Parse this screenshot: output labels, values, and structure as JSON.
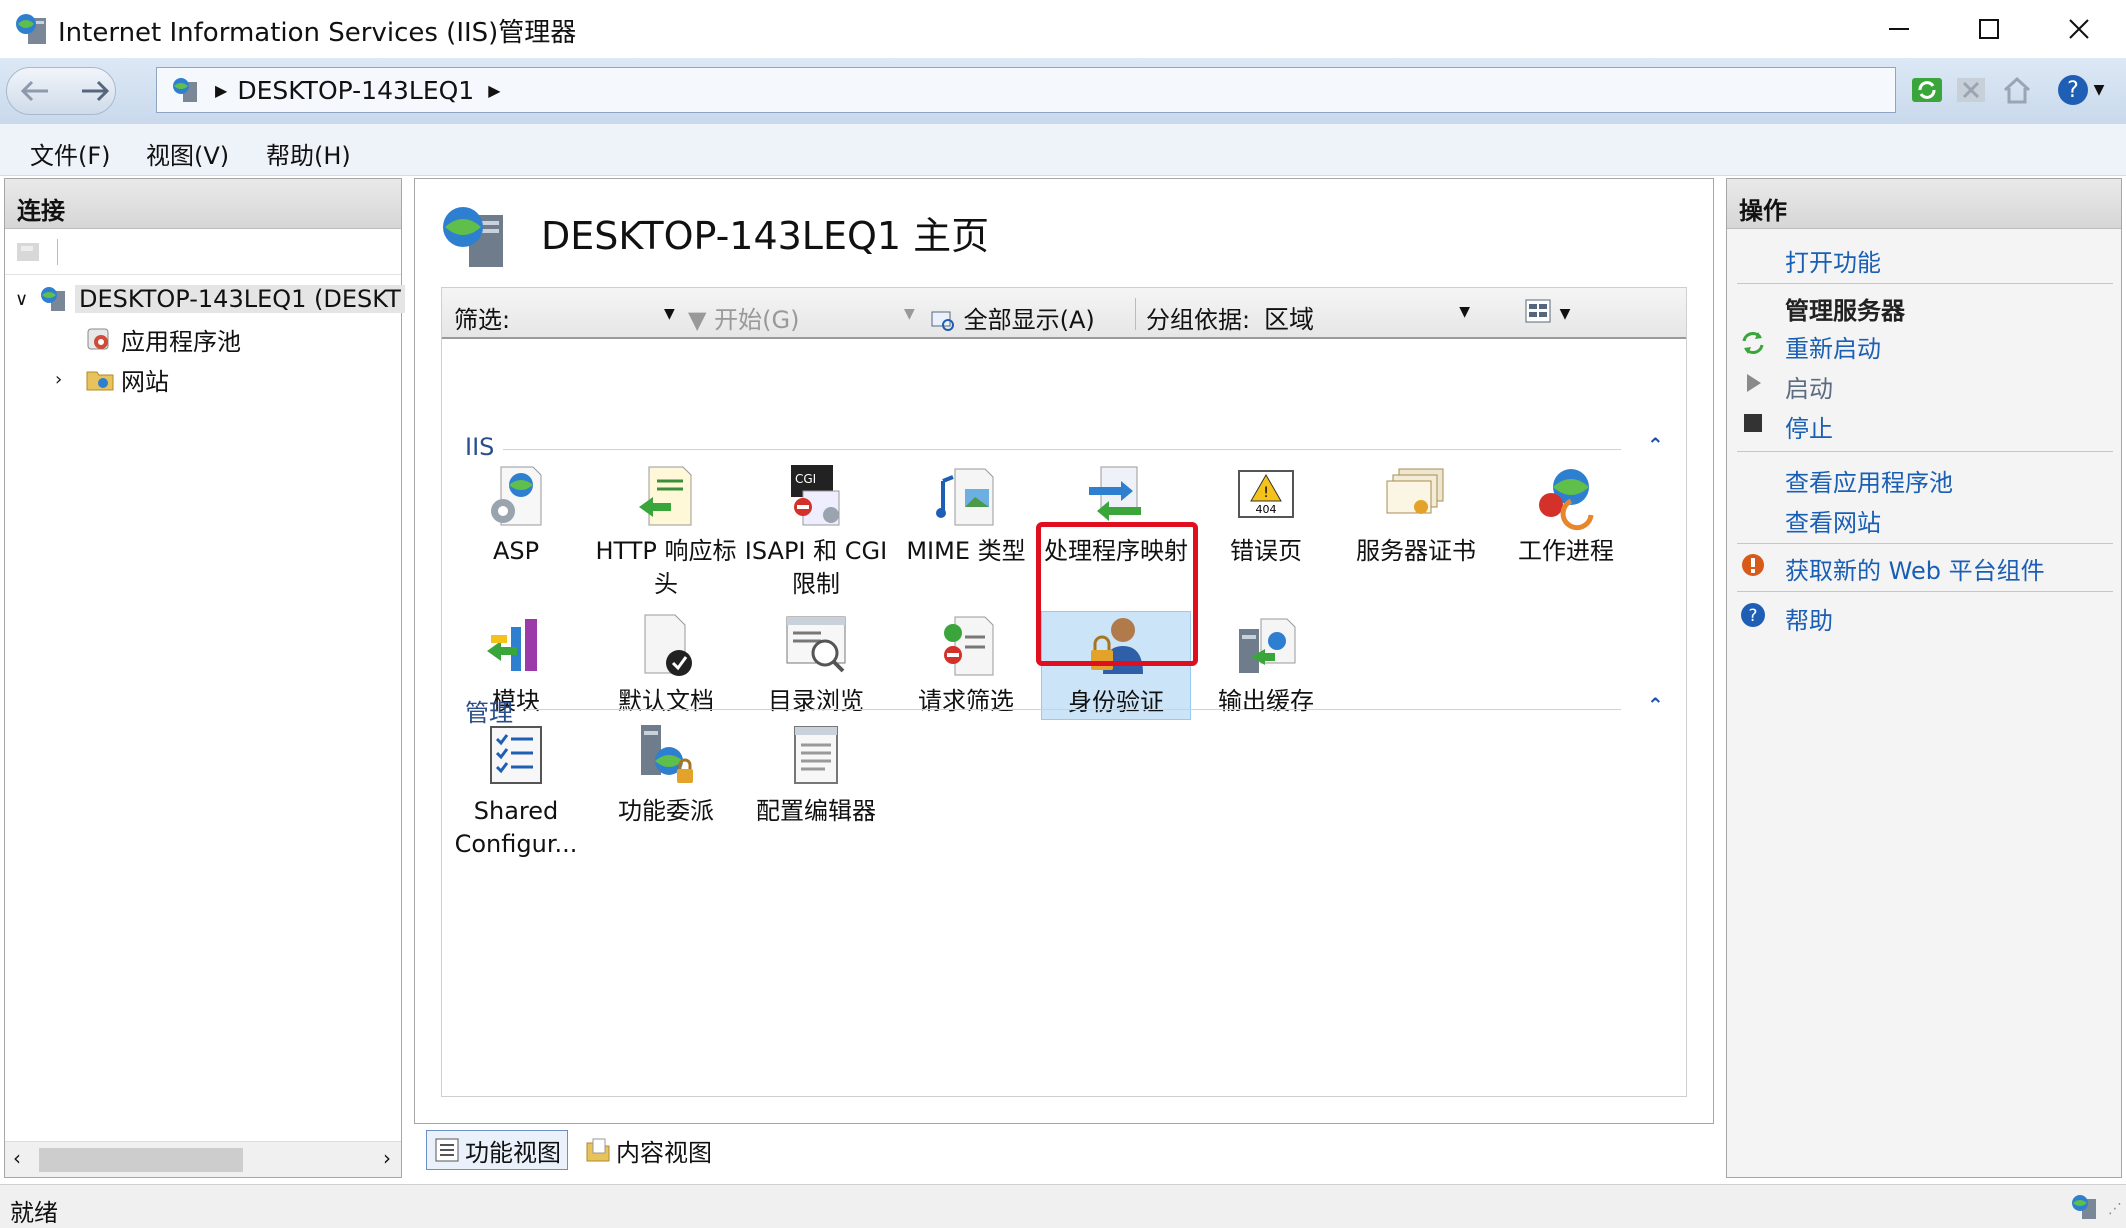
{
  "window": {
    "title": "Internet Information Services (IIS)管理器"
  },
  "address": {
    "crumbs": [
      "DESKTOP-143LEQ1"
    ]
  },
  "menu": {
    "items": [
      "文件(F)",
      "视图(V)",
      "帮助(H)"
    ]
  },
  "connections": {
    "title": "连接",
    "tree": {
      "root": "DESKTOP-143LEQ1 (DESKT",
      "children": [
        "应用程序池",
        "网站"
      ]
    }
  },
  "center": {
    "title": "DESKTOP-143LEQ1 主页",
    "filter": {
      "label": "筛选:",
      "value": "",
      "start": "开始(G)",
      "show_all": "全部显示(A)",
      "group_by_label": "分组依据:",
      "group_by_value": "区域"
    },
    "groups": [
      {
        "name": "IIS",
        "features": [
          {
            "label": "ASP",
            "icon": "asp-icon"
          },
          {
            "label": "HTTP 响应标头",
            "icon": "http-headers-icon"
          },
          {
            "label": "ISAPI 和 CGI 限制",
            "icon": "isapi-cgi-icon"
          },
          {
            "label": "MIME 类型",
            "icon": "mime-icon"
          },
          {
            "label": "处理程序映射",
            "icon": "handler-mappings-icon"
          },
          {
            "label": "错误页",
            "icon": "error-page-icon"
          },
          {
            "label": "服务器证书",
            "icon": "server-certificate-icon"
          },
          {
            "label": "工作进程",
            "icon": "worker-process-icon"
          },
          {
            "label": "模块",
            "icon": "modules-icon"
          },
          {
            "label": "默认文档",
            "icon": "default-document-icon"
          },
          {
            "label": "目录浏览",
            "icon": "directory-browsing-icon"
          },
          {
            "label": "请求筛选",
            "icon": "request-filtering-icon"
          },
          {
            "label": "身份验证",
            "icon": "authentication-icon",
            "selected": true
          },
          {
            "label": "输出缓存",
            "icon": "output-caching-icon"
          }
        ]
      },
      {
        "name": "管理",
        "features": [
          {
            "label": "Shared Configur...",
            "icon": "shared-configuration-icon"
          },
          {
            "label": "功能委派",
            "icon": "feature-delegation-icon"
          },
          {
            "label": "配置编辑器",
            "icon": "configuration-editor-icon"
          }
        ]
      }
    ]
  },
  "view_tabs": [
    "功能视图",
    "内容视图"
  ],
  "actions": {
    "title": "操作",
    "open_feature": "打开功能",
    "manage_server_title": "管理服务器",
    "restart": "重新启动",
    "start": "启动",
    "stop": "停止",
    "view_app_pools": "查看应用程序池",
    "view_sites": "查看网站",
    "get_web_platform": "获取新的 Web 平台组件",
    "help": "帮助"
  },
  "status": {
    "text": "就绪"
  },
  "colors": {
    "accent": "#1a5fb4",
    "highlight": "#e00f1f",
    "selected_bg": "#cce4f7"
  }
}
